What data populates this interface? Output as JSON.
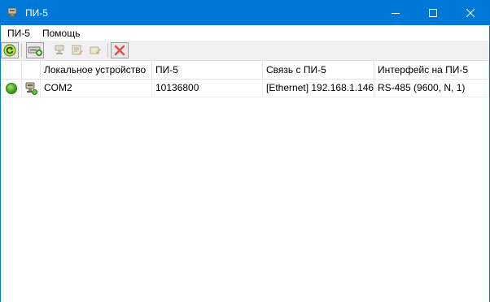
{
  "window": {
    "title": "ПИ-5"
  },
  "menu": {
    "items": [
      "ПИ-5",
      "Помощь"
    ]
  },
  "toolbar": {
    "icons": [
      "refresh-icon",
      "add-device-icon",
      "device-settings-icon",
      "device-config-icon",
      "device-edit-icon",
      "delete-icon"
    ]
  },
  "table": {
    "columns": [
      "",
      "",
      "Локальное устройство",
      "ПИ-5",
      "Связь с ПИ-5",
      "Интерфейс на ПИ-5"
    ],
    "rows": [
      {
        "status": "online",
        "local_device": "COM2",
        "pi5": "10136800",
        "link": "[Ethernet] 192.168.1.146",
        "interface": "RS-485 (9600, N, 1)"
      }
    ]
  },
  "colors": {
    "titlebar": "#0078d7",
    "status_online": "#3aa018"
  }
}
